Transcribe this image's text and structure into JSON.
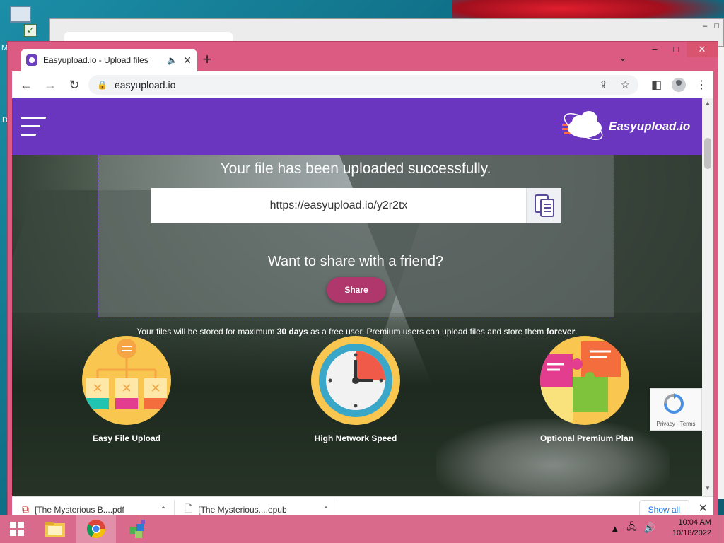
{
  "desktop": {
    "letters": [
      "M",
      "D"
    ]
  },
  "browser": {
    "tab_title": "Easyupload.io - Upload files",
    "tab_audio_icon": "speaker-icon",
    "new_tab_label": "+",
    "omnibox_url": "easyupload.io"
  },
  "site": {
    "logo_text": "Easyupload.io",
    "success_message": "Your file has been uploaded successfully.",
    "share_link": "https://easyupload.io/y2r2tx",
    "share_prompt": "Want to share with a friend?",
    "share_button": "Share",
    "notice": {
      "part1": "Your files will be stored for maximum ",
      "bold1": "30 days",
      "part2": " as a free user. Premium users can upload files and store them ",
      "bold2": "forever",
      "part3": "."
    },
    "features": [
      {
        "name": "Easy File Upload"
      },
      {
        "name": "High Network Speed"
      },
      {
        "name": "Optional Premium Plan"
      }
    ],
    "recaptcha": {
      "text": "Privacy - Terms"
    }
  },
  "downloads": {
    "items": [
      {
        "name": "[The Mysterious B....pdf"
      },
      {
        "name": "[The Mysterious....epub"
      }
    ],
    "show_all": "Show all"
  },
  "taskbar": {
    "time": "10:04 AM",
    "date": "10/18/2022"
  },
  "colors": {
    "header": "#6a35bf",
    "share_button": "#b0376b",
    "window_frame": "#dc5b83",
    "taskbar": "#d96a8c"
  }
}
